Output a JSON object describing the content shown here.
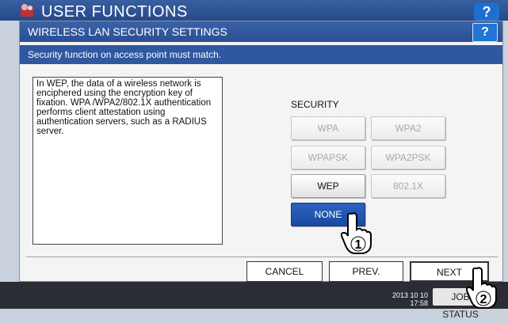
{
  "background": {
    "title": "USER FUNCTIONS",
    "help_label": "?",
    "clock_date": "2013 10 10",
    "clock_time": "17:58",
    "job_status_label": "JOB STATUS"
  },
  "dialog": {
    "title": "WIRELESS LAN SECURITY SETTINGS",
    "help_label": "?",
    "message": "Security function on access point must match.",
    "description": "In WEP, the data of a wireless network is enciphered using the encryption key of fixation. WPA /WPA2/802.1X authentication performs client attestation using authentication servers, such as a RADIUS server.",
    "security_label": "SECURITY",
    "security_options": {
      "wpa": "WPA",
      "wpa2": "WPA2",
      "wpapsk": "WPAPSK",
      "wpa2psk": "WPA2PSK",
      "wep": "WEP",
      "x8021": "802.1X",
      "none": "NONE"
    },
    "selected_option": "NONE",
    "buttons": {
      "cancel": "CANCEL",
      "prev": "PREV.",
      "next": "NEXT"
    }
  },
  "callouts": [
    "1",
    "2"
  ]
}
